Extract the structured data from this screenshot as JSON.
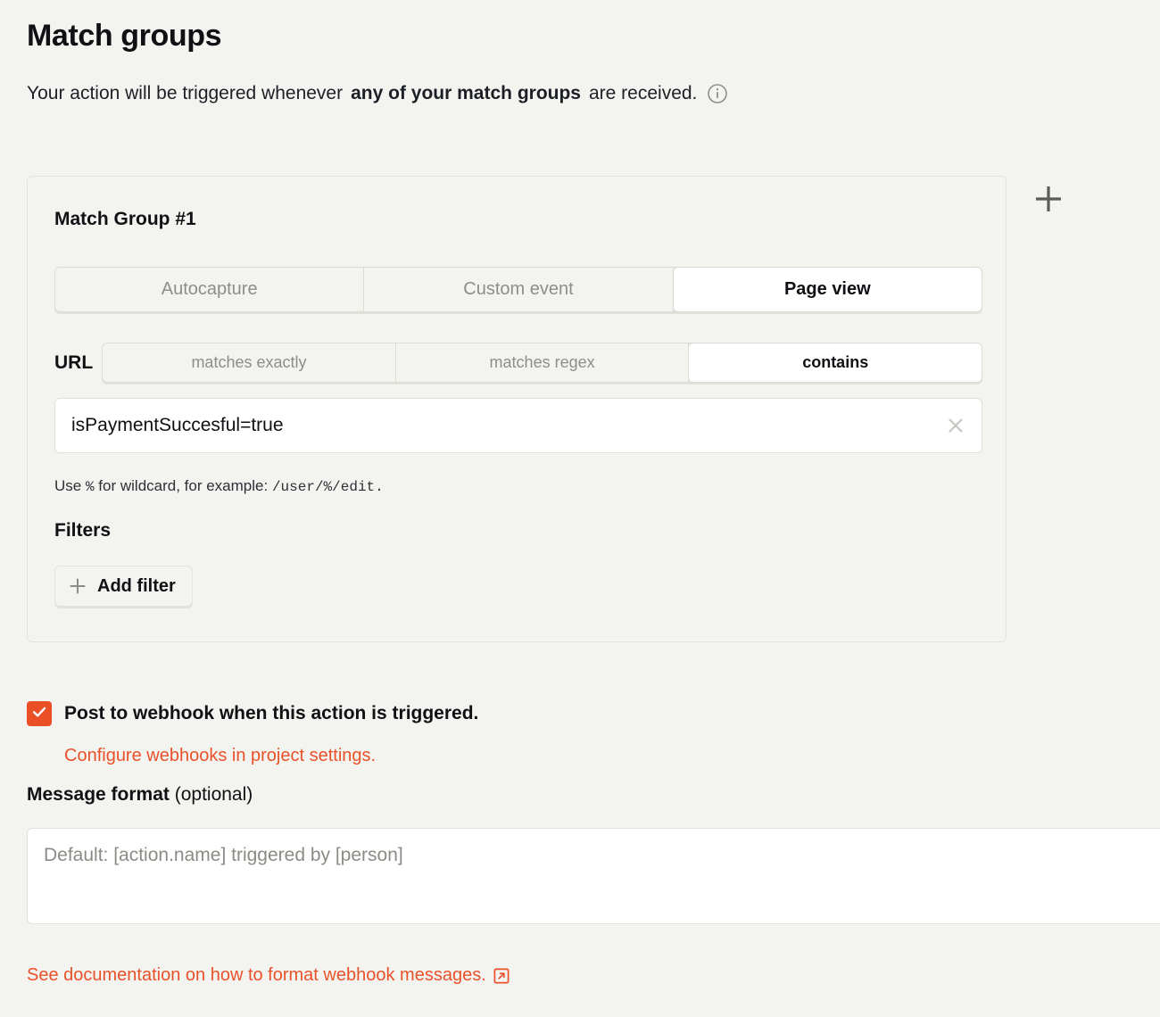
{
  "header": {
    "title": "Match groups",
    "subtitle_prefix": "Your action will be triggered whenever ",
    "subtitle_strong": "any of your match groups",
    "subtitle_suffix": " are received.",
    "info_icon": "info-icon"
  },
  "match_group": {
    "title": "Match Group #1",
    "event_tabs": [
      {
        "label": "Autocapture",
        "active": false
      },
      {
        "label": "Custom event",
        "active": false
      },
      {
        "label": "Page view",
        "active": true
      }
    ],
    "url": {
      "label": "URL",
      "match_tabs": [
        {
          "label": "matches exactly",
          "active": false
        },
        {
          "label": "matches regex",
          "active": false
        },
        {
          "label": "contains",
          "active": true
        }
      ],
      "value": "isPaymentSuccesful=true",
      "placeholder": "",
      "clear_icon": "close-icon",
      "hint_prefix": "Use ",
      "hint_mono_1": "%",
      "hint_middle": " for wildcard, for example: ",
      "hint_mono_2": "/user/%/edit.",
      "hint_suffix": ""
    },
    "filters": {
      "title": "Filters",
      "add_filter_label": "Add filter",
      "add_filter_icon": "plus-icon"
    },
    "add_group_icon": "plus-icon"
  },
  "webhook": {
    "checkbox_checked": true,
    "checkbox_icon": "check-icon",
    "label": "Post to webhook when this action is triggered.",
    "configure_link": "Configure webhooks in project settings.",
    "message_format_label": "Message format",
    "message_format_optional": " (optional)",
    "message_value": "",
    "message_placeholder": "Default: [action.name] triggered by [person]",
    "doc_link": "See documentation on how to format webhook messages.",
    "doc_link_icon": "external-link-icon"
  },
  "colors": {
    "background": "#f3f4ef",
    "accent": "#e8512a",
    "checkbox": "#ea4f27",
    "text": "#111014",
    "muted_text": "#8e8e88",
    "card_border": "#e3e3dd"
  }
}
